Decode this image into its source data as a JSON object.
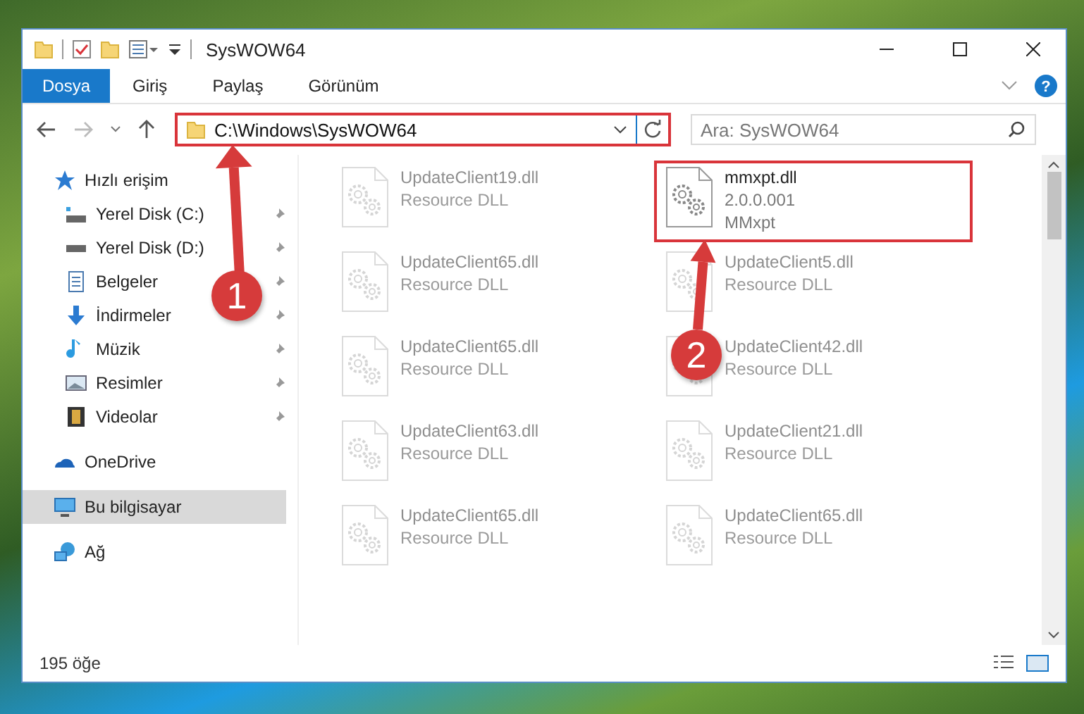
{
  "window": {
    "title": "SysWOW64"
  },
  "help_button": {
    "label": "?"
  },
  "ribbon_tabs": [
    {
      "label": "Dosya",
      "selected": true
    },
    {
      "label": "Giriş",
      "selected": false
    },
    {
      "label": "Paylaş",
      "selected": false
    },
    {
      "label": "Görünüm",
      "selected": false
    }
  ],
  "address_bar": {
    "path": "C:\\Windows\\SysWOW64",
    "highlighted": true
  },
  "search": {
    "placeholder": "Ara: SysWOW64"
  },
  "sidebar": {
    "items": [
      {
        "label": "Hızlı erişim",
        "kind": "section",
        "selected": false
      },
      {
        "label": "Yerel Disk (C:)",
        "kind": "pinned",
        "selected": false
      },
      {
        "label": "Yerel Disk (D:)",
        "kind": "pinned",
        "selected": false
      },
      {
        "label": "Belgeler",
        "kind": "pinned",
        "selected": false
      },
      {
        "label": "İndirmeler",
        "kind": "pinned",
        "selected": false
      },
      {
        "label": "Müzik",
        "kind": "pinned",
        "selected": false
      },
      {
        "label": "Resimler",
        "kind": "pinned",
        "selected": false
      },
      {
        "label": "Videolar",
        "kind": "pinned",
        "selected": false
      },
      {
        "label": "OneDrive",
        "kind": "section",
        "selected": false
      },
      {
        "label": "Bu bilgisayar",
        "kind": "section",
        "selected": true
      },
      {
        "label": "Ağ",
        "kind": "section",
        "selected": false
      }
    ]
  },
  "files": [
    {
      "name": "UpdateClient19.dll",
      "lines": [
        "Resource DLL"
      ],
      "blurred": true,
      "highlighted": false
    },
    {
      "name": "mmxpt.dll",
      "lines": [
        "2.0.0.001",
        "MMxpt"
      ],
      "blurred": false,
      "highlighted": true
    },
    {
      "name": "UpdateClient65.dll",
      "lines": [
        "Resource DLL"
      ],
      "blurred": true,
      "highlighted": false
    },
    {
      "name": "UpdateClient5.dll",
      "lines": [
        "Resource DLL"
      ],
      "blurred": true,
      "highlighted": false
    },
    {
      "name": "UpdateClient65.dll",
      "lines": [
        "Resource DLL"
      ],
      "blurred": true,
      "highlighted": false
    },
    {
      "name": "UpdateClient42.dll",
      "lines": [
        "Resource DLL"
      ],
      "blurred": true,
      "highlighted": false
    },
    {
      "name": "UpdateClient63.dll",
      "lines": [
        "Resource DLL"
      ],
      "blurred": true,
      "highlighted": false
    },
    {
      "name": "UpdateClient21.dll",
      "lines": [
        "Resource DLL"
      ],
      "blurred": true,
      "highlighted": false
    },
    {
      "name": "UpdateClient65.dll",
      "lines": [
        "Resource DLL"
      ],
      "blurred": true,
      "highlighted": false
    },
    {
      "name": "UpdateClient65.dll",
      "lines": [
        "Resource DLL"
      ],
      "blurred": true,
      "highlighted": false
    }
  ],
  "status_bar": {
    "item_count": "195 öğe"
  },
  "annotations": [
    {
      "number": "1"
    },
    {
      "number": "2"
    }
  ]
}
